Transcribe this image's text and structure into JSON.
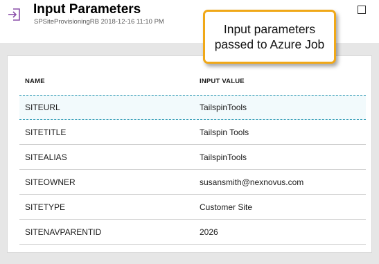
{
  "header": {
    "title": "Input Parameters",
    "subtitle": "SPSiteProvisioningRB 2018-12-16 11:10 PM",
    "icon": "input-arrow-icon",
    "icon_color": "#8a4fa8"
  },
  "callout": {
    "line1": "Input parameters",
    "line2": "passed to Azure Job",
    "border_color": "#f0a818"
  },
  "table": {
    "columns": [
      "NAME",
      "INPUT VALUE"
    ],
    "rows": [
      {
        "name": "SITEURL",
        "value": "TailspinTools",
        "selected": true
      },
      {
        "name": "SITETITLE",
        "value": "Tailspin Tools",
        "selected": false
      },
      {
        "name": "SITEALIAS",
        "value": "TailspinTools",
        "selected": false
      },
      {
        "name": "SITEOWNER",
        "value": "susansmith@nexnovus.com",
        "selected": false
      },
      {
        "name": "SITETYPE",
        "value": "Customer Site",
        "selected": false
      },
      {
        "name": "SITENAVPARENTID",
        "value": "2026",
        "selected": false
      }
    ]
  },
  "colors": {
    "content_background": "#e6e6e6",
    "selected_row_border": "#3a9fb8",
    "selected_row_background": "#f2fafc"
  }
}
